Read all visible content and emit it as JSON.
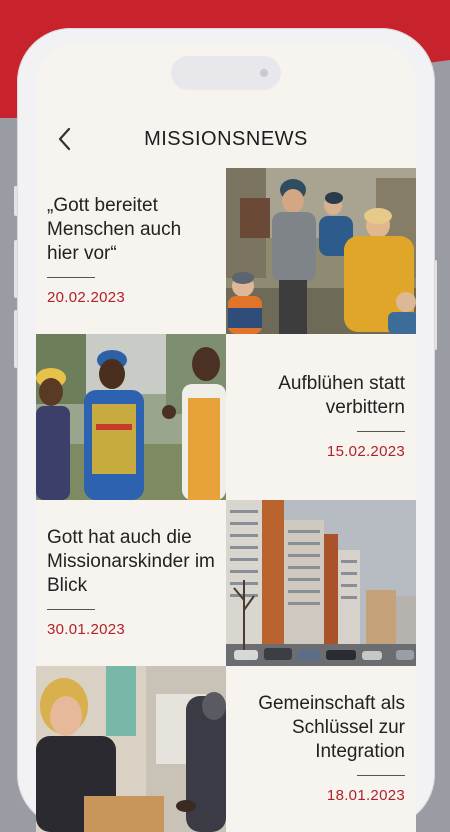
{
  "header": {
    "title": "MISSIONSNEWS",
    "back_icon": "chevron-left-icon"
  },
  "colors": {
    "brand_red": "#c8232c",
    "date_red": "#b0222a",
    "card_background": "#f7f3ef"
  },
  "news": [
    {
      "headline": "„Gott bereitet Menschen auch hier vor“",
      "date": "20.02.2023",
      "image": "family-photo"
    },
    {
      "headline": "Aufblühen statt verbittern",
      "date": "15.02.2023",
      "image": "women-photo"
    },
    {
      "headline": "Gott hat auch die Missionarskinder im Blick",
      "date": "30.01.2023",
      "image": "apartment-blocks-photo"
    },
    {
      "headline": "Gemeinschaft als Schlüssel zur Integration",
      "date": "18.01.2023",
      "image": "classroom-photo"
    }
  ]
}
